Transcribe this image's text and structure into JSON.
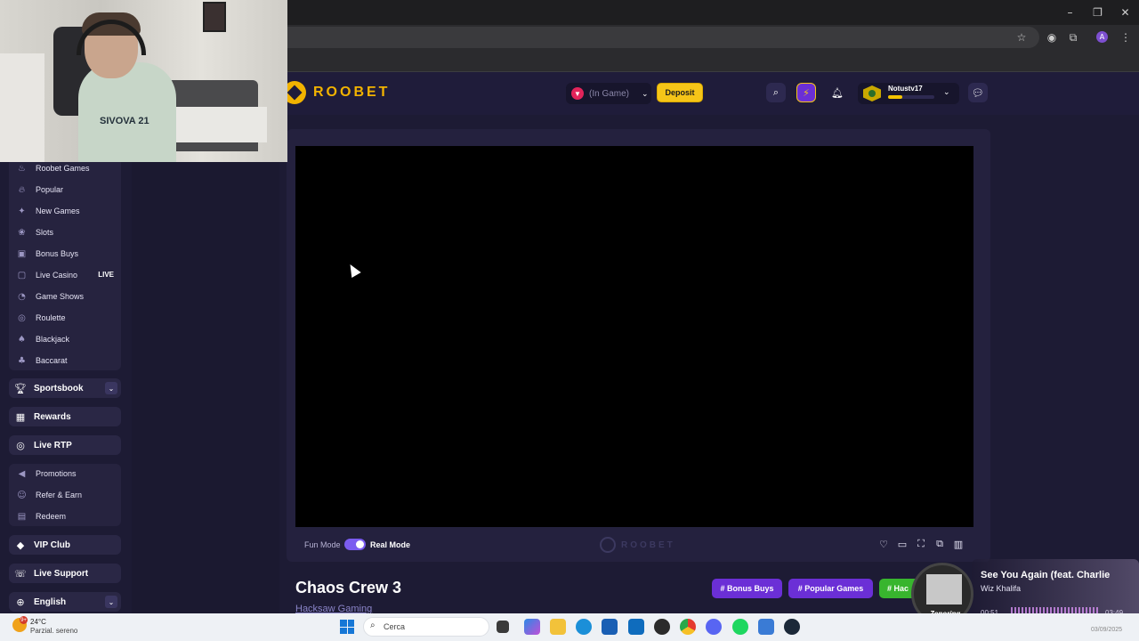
{
  "browser": {
    "controls": {
      "minimize": "–",
      "restore": "❐",
      "close": "✕"
    }
  },
  "header": {
    "logo_text": "ROOBET",
    "balance_label": "(In Game)",
    "deposit_label": "Deposit",
    "username": "Notustv17",
    "xp_progress": 0.3
  },
  "sidebar": {
    "casino_items": [
      {
        "label": "Roobet Games",
        "icon": "flame-icon"
      },
      {
        "label": "Popular",
        "icon": "fire-icon"
      },
      {
        "label": "New Games",
        "icon": "sparkle-icon"
      },
      {
        "label": "Slots",
        "icon": "cherry-icon"
      },
      {
        "label": "Bonus Buys",
        "icon": "gift-icon"
      },
      {
        "label": "Live Casino",
        "icon": "tv-icon",
        "badge": "LIVE"
      },
      {
        "label": "Game Shows",
        "icon": "wheel-icon"
      },
      {
        "label": "Roulette",
        "icon": "roulette-icon"
      },
      {
        "label": "Blackjack",
        "icon": "spade-icon"
      },
      {
        "label": "Baccarat",
        "icon": "club-icon"
      }
    ],
    "sportsbook": "Sportsbook",
    "rewards": "Rewards",
    "live_rtp": "Live RTP",
    "promo_items": [
      {
        "label": "Promotions",
        "icon": "megaphone-icon"
      },
      {
        "label": "Refer & Earn",
        "icon": "users-icon"
      },
      {
        "label": "Redeem",
        "icon": "ticket-icon"
      }
    ],
    "vip_club": "VIP Club",
    "live_support": "Live Support",
    "language": "English"
  },
  "game": {
    "fun_mode": "Fun Mode",
    "real_mode": "Real Mode",
    "watermark": "ROOBET",
    "title": "Chaos Crew 3",
    "provider": "Hacksaw Gaming",
    "tags": [
      "# Bonus Buys",
      "# Popular Games",
      "# Hac"
    ]
  },
  "webcam": {
    "shirt_text": "SIVOVA 21"
  },
  "taskbar": {
    "temperature": "24°C",
    "weather": "Parzial. sereno",
    "weather_badge": "9+",
    "search_placeholder": "Cerca",
    "date_partial": "03/09/2025"
  },
  "now_playing": {
    "title": "See You Again (feat. Charlie",
    "artist": "Wiz Khalifa",
    "time_elapsed": "00:51",
    "time_total": "03:49",
    "progress": 0.22,
    "cover_text": "Zenoring"
  },
  "colors": {
    "accent_gold": "#f5c518",
    "accent_purple": "#6b2fd6",
    "tag_green": "#38b52e"
  }
}
